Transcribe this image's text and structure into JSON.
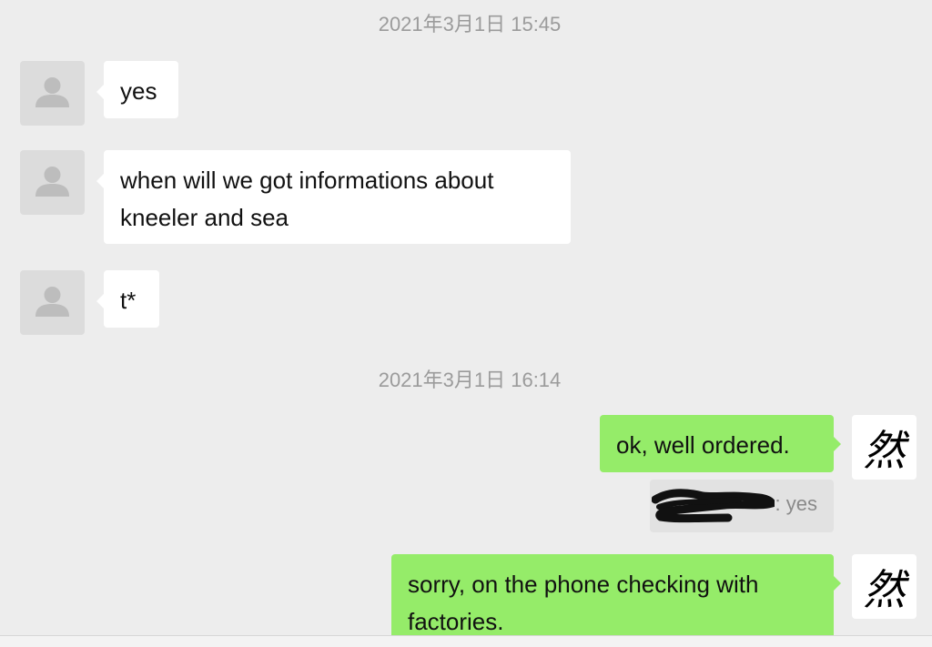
{
  "conversation": {
    "timestamps": [
      "2021年3月1日 15:45",
      "2021年3月1日 16:14"
    ],
    "messages": [
      {
        "direction": "incoming",
        "text": "yes"
      },
      {
        "direction": "incoming",
        "text": "when will we got informations about kneeler and sea"
      },
      {
        "direction": "incoming",
        "text": "t*"
      },
      {
        "direction": "outgoing",
        "text": "ok, well ordered."
      },
      {
        "direction": "outgoing",
        "text": "sorry, on the phone checking with factories."
      }
    ],
    "quote": {
      "text": ": yes"
    },
    "self_avatar_glyph": "然",
    "icons": {
      "default_avatar": "default-avatar-icon"
    }
  },
  "colors": {
    "background": "#ededed",
    "incoming_bubble": "#ffffff",
    "outgoing_bubble": "#95ec69",
    "timestamp_text": "#9b9b9b"
  }
}
